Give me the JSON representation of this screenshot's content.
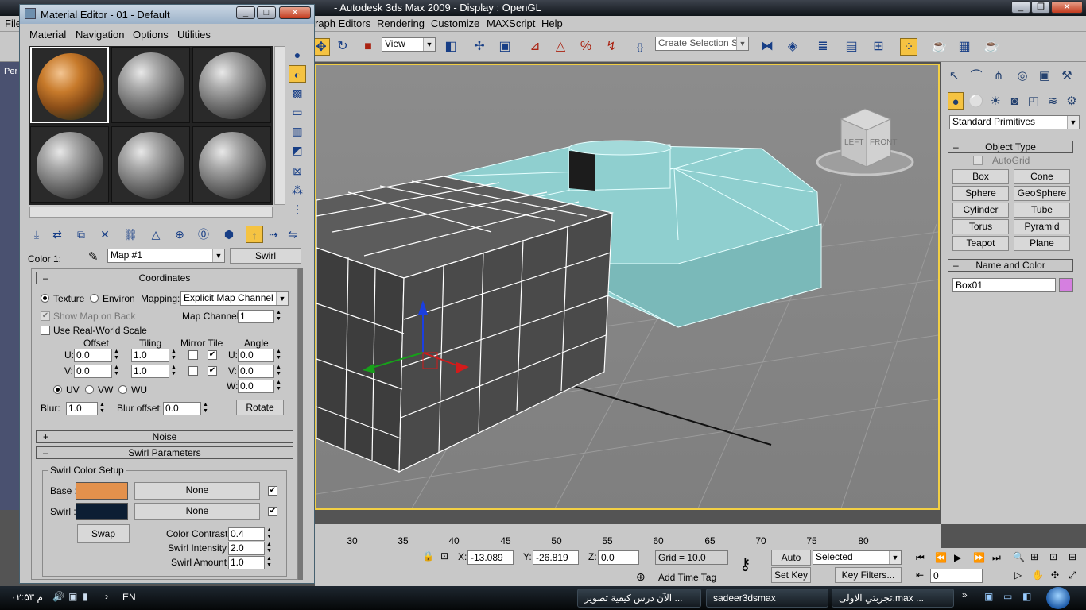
{
  "app": {
    "title": "- Autodesk 3ds Max  2009          - Display : OpenGL",
    "menus": [
      "File",
      "raph Editors",
      "Rendering",
      "Customize",
      "MAXScript",
      "Help"
    ],
    "toolbar": {
      "view_dropdown": "View",
      "selection_set_placeholder": "Create Selection Se",
      "icon_names": [
        "select-move-icon",
        "rotate-icon",
        "scale-icon",
        "snap-3d-icon",
        "angle-snap-icon",
        "percent-snap-icon",
        "spinner-snap-icon",
        "named-selection-icon",
        "mirror-icon",
        "align-icon",
        "layers-icon",
        "curve-editor-icon",
        "schematic-icon",
        "material-editor-icon",
        "render-setup-icon",
        "render-frame-icon",
        "quick-render-icon"
      ]
    },
    "viewport_label": "Per"
  },
  "material_editor": {
    "title": "Material Editor - 01 - Default",
    "menu": [
      "Material",
      "Navigation",
      "Options",
      "Utilities"
    ],
    "color_label": "Color 1:",
    "map_name": "Map #1",
    "map_type_button": "Swirl",
    "coordinates": {
      "header": "Coordinates",
      "texture_label": "Texture",
      "environ_label": "Environ",
      "mapping_label": "Mapping:",
      "mapping_value": "Explicit Map Channel",
      "show_map_on_back": "Show Map on Back",
      "map_channel_label": "Map Channel:",
      "map_channel_value": "1",
      "use_real_world": "Use Real-World Scale",
      "offset_label": "Offset",
      "tiling_label": "Tiling",
      "mirror_tile_label": "Mirror Tile",
      "angle_label": "Angle",
      "u_label": "U:",
      "v_label": "V:",
      "w_label": "W:",
      "u_offset": "0.0",
      "v_offset": "0.0",
      "u_tiling": "1.0",
      "v_tiling": "1.0",
      "u_angle": "0.0",
      "v_angle": "0.0",
      "w_angle": "0.0",
      "uv_label": "UV",
      "vw_label": "VW",
      "wu_label": "WU",
      "blur_label": "Blur:",
      "blur_value": "1.0",
      "blur_offset_label": "Blur offset:",
      "blur_offset_value": "0.0",
      "rotate_button": "Rotate"
    },
    "noise_header": "Noise",
    "swirl": {
      "header": "Swirl Parameters",
      "group_label": "Swirl Color Setup",
      "base_label": "Base :",
      "base_color": "#e3914c",
      "base_map": "None",
      "swirl_label": "Swirl :",
      "swirl_color": "#0c1e33",
      "swirl_map": "None",
      "swap_button": "Swap",
      "color_contrast_label": "Color Contrast :",
      "color_contrast": "0.4",
      "swirl_intensity_label": "Swirl Intensity :",
      "swirl_intensity": "2.0",
      "swirl_amount_label": "Swirl Amount :",
      "swirl_amount": "1.0"
    }
  },
  "command_panel": {
    "category": "Standard Primitives",
    "object_type_header": "Object Type",
    "autogrid_label": "AutoGrid",
    "buttons": [
      "Box",
      "Cone",
      "Sphere",
      "GeoSphere",
      "Cylinder",
      "Tube",
      "Torus",
      "Pyramid",
      "Teapot",
      "Plane"
    ],
    "name_color_header": "Name and Color",
    "object_name": "Box01",
    "object_color": "#d57fe0"
  },
  "viewcube": {
    "left": "LEFT",
    "front": "FRONT"
  },
  "timeline": {
    "ticks": [
      "30",
      "35",
      "40",
      "45",
      "50",
      "55",
      "60",
      "65",
      "70",
      "75",
      "80"
    ]
  },
  "status": {
    "x_label": "X:",
    "x_value": "-13.089",
    "y_label": "Y:",
    "y_value": "-26.819",
    "z_label": "Z:",
    "z_value": "0.0",
    "grid": "Grid = 10.0",
    "add_time_tag": "Add Time Tag",
    "auto_key": "Auto Key",
    "selected": "Selected",
    "set_key": "Set Key",
    "key_filters": "Key Filters...",
    "frame": "0"
  },
  "taskbar": {
    "clock": "۰۲:۵۳ م",
    "lang": "EN",
    "tasks": [
      "الآن درس كيفية تصوير ...",
      "sadeer3dsmax",
      "تجربتي الاولى.max ..."
    ]
  }
}
